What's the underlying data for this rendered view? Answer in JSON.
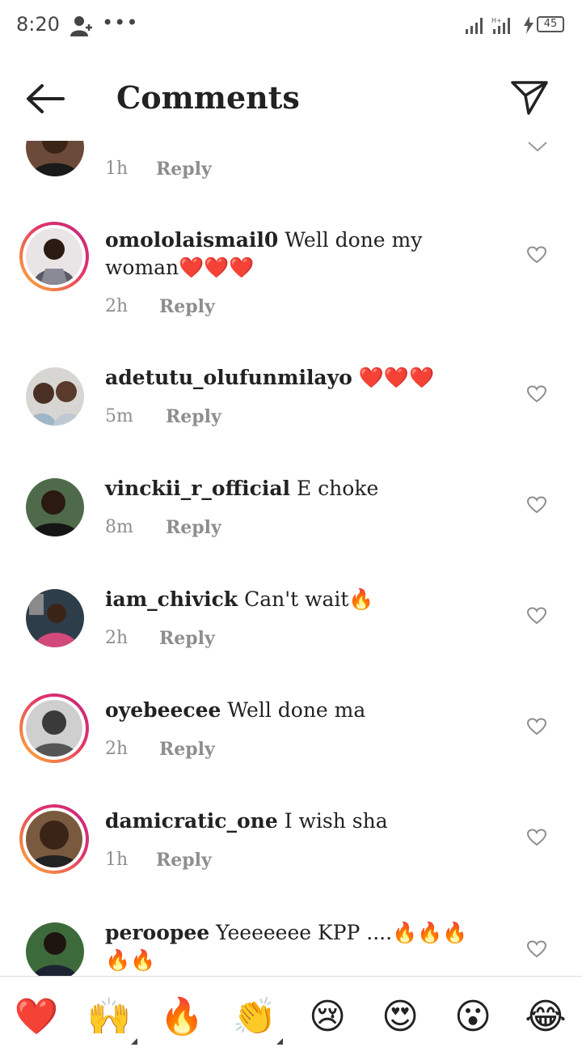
{
  "status_bar": {
    "time": "8:20",
    "battery": "45"
  },
  "header": {
    "title": "Comments"
  },
  "first_comment": {
    "time": "1h",
    "reply": "Reply"
  },
  "comments": [
    {
      "username": "omololaismail0",
      "text": " Well done my woman❤️❤️❤️",
      "time": "2h",
      "reply": "Reply"
    },
    {
      "username": "adetutu_olufunmilayo",
      "text": " ❤️❤️❤️",
      "time": "5m",
      "reply": "Reply"
    },
    {
      "username": "vinckii_r_official",
      "text": " E choke",
      "time": "8m",
      "reply": "Reply"
    },
    {
      "username": "iam_chivick",
      "text": " Can't wait🔥",
      "time": "2h",
      "reply": "Reply"
    },
    {
      "username": "oyebeecee",
      "text": " Well done ma",
      "time": "2h",
      "reply": "Reply"
    },
    {
      "username": "damicratic_one",
      "text": " I wish sha",
      "time": "1h",
      "reply": "Reply"
    },
    {
      "username": "peroopee",
      "text": " Yeeeeeee KPP ....🔥🔥🔥🔥🔥",
      "time": "",
      "reply": ""
    }
  ],
  "emoji_bar": [
    "❤️",
    "🙌",
    "🔥",
    "👏",
    "😢",
    "😍",
    "😮",
    "😂"
  ],
  "colors": {
    "ring_start": "#f9a13b",
    "ring_end": "#c2277f",
    "secondary_text": "#8e8e8e"
  }
}
